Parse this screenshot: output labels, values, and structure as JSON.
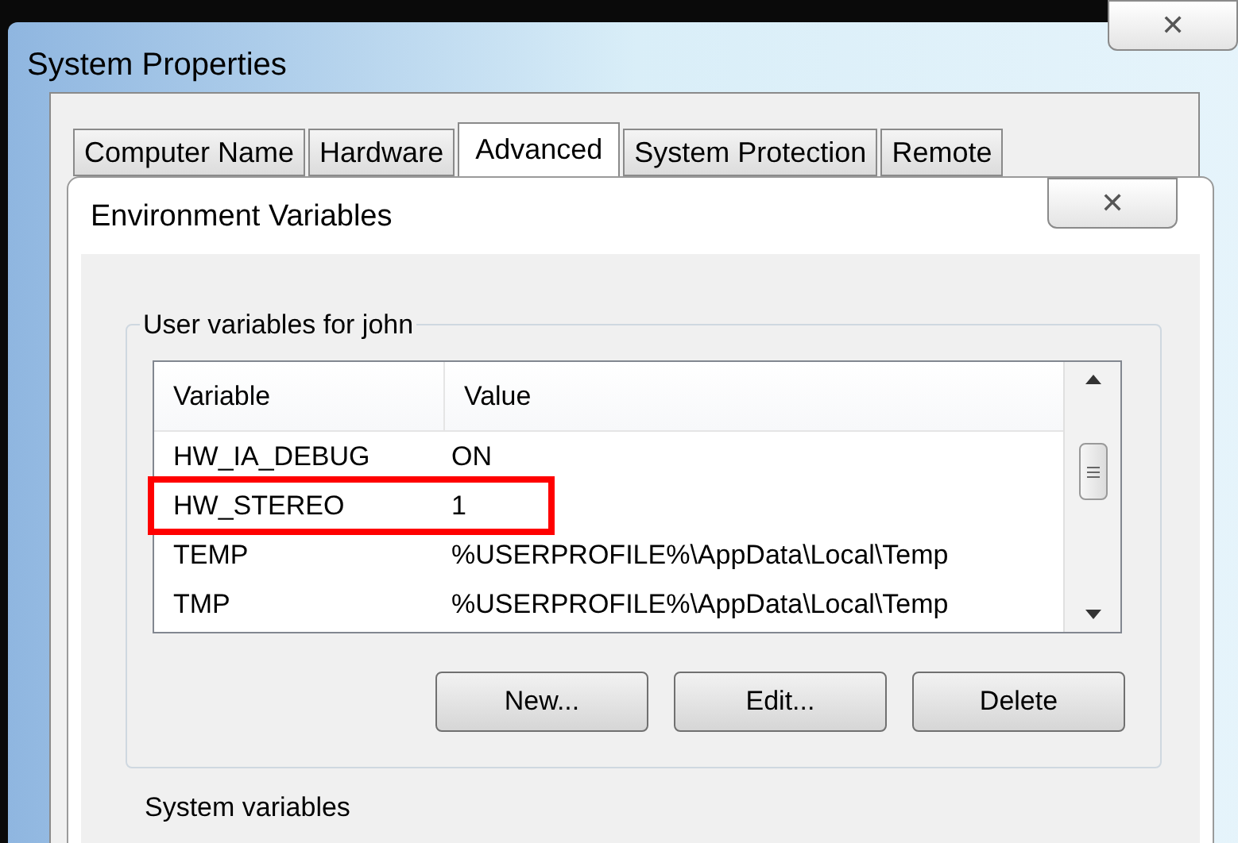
{
  "window": {
    "title": "System Properties",
    "close": "✕"
  },
  "tabs": [
    {
      "label": "Computer Name",
      "selected": false
    },
    {
      "label": "Hardware",
      "selected": false
    },
    {
      "label": "Advanced",
      "selected": true
    },
    {
      "label": "System Protection",
      "selected": false
    },
    {
      "label": "Remote",
      "selected": false
    }
  ],
  "dialog": {
    "title": "Environment Variables",
    "close": "✕"
  },
  "user_variables": {
    "label": "User variables for john",
    "columns": [
      "Variable",
      "Value"
    ],
    "rows": [
      {
        "variable": "HW_IA_DEBUG",
        "value": "ON",
        "highlighted": false
      },
      {
        "variable": "HW_STEREO",
        "value": "1",
        "highlighted": true
      },
      {
        "variable": "TEMP",
        "value": "%USERPROFILE%\\AppData\\Local\\Temp",
        "highlighted": false
      },
      {
        "variable": "TMP",
        "value": "%USERPROFILE%\\AppData\\Local\\Temp",
        "highlighted": false
      }
    ],
    "buttons": [
      "New...",
      "Edit...",
      "Delete"
    ]
  },
  "system_variables": {
    "label": "System variables"
  }
}
